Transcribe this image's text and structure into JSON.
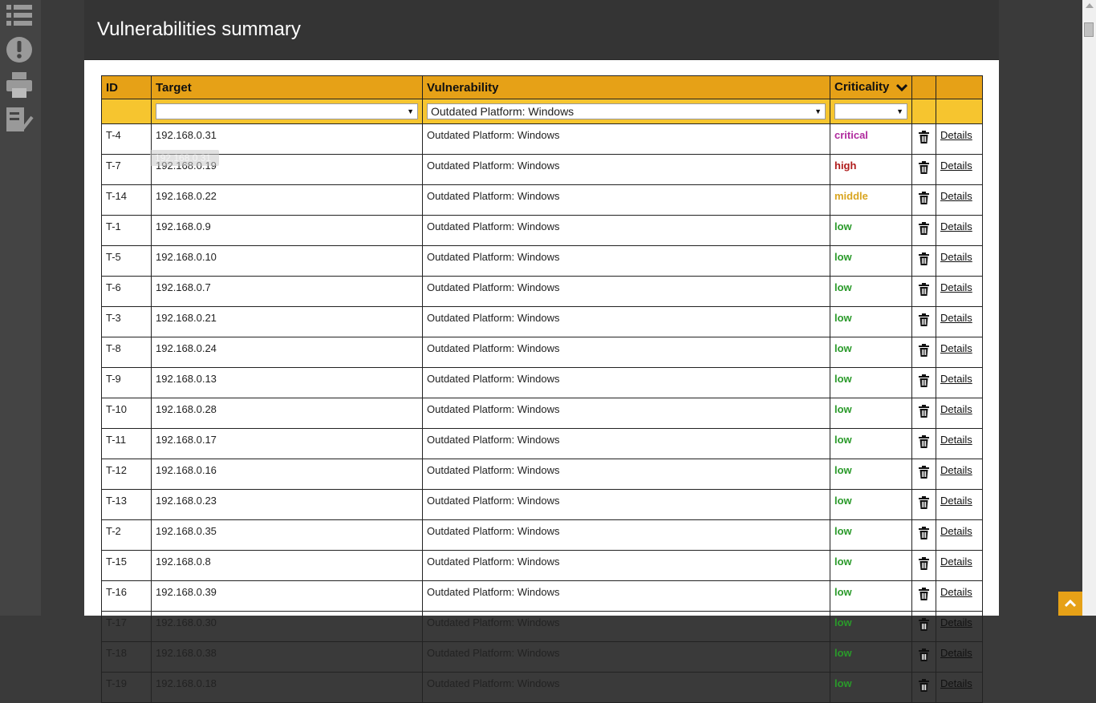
{
  "header": {
    "title": "Vulnerabilities summary"
  },
  "sidebar": {
    "icons": [
      "list-icon",
      "alert-icon",
      "print-icon",
      "checklist-icon"
    ]
  },
  "table": {
    "headers": {
      "id": "ID",
      "target": "Target",
      "vulnerability": "Vulnerability",
      "criticality": "Criticality"
    },
    "filters": {
      "target": "",
      "vulnerability": "Outdated Platform: Windows",
      "criticality": ""
    },
    "details_label": "Details",
    "rows": [
      {
        "id": "T-4",
        "target": "192.168.0.31",
        "vulnerability": "Outdated Platform: Windows",
        "criticality": "critical"
      },
      {
        "id": "T-7",
        "target": "192.168.0.19",
        "vulnerability": "Outdated Platform: Windows",
        "criticality": "high"
      },
      {
        "id": "T-14",
        "target": "192.168.0.22",
        "vulnerability": "Outdated Platform: Windows",
        "criticality": "middle"
      },
      {
        "id": "T-1",
        "target": "192.168.0.9",
        "vulnerability": "Outdated Platform: Windows",
        "criticality": "low"
      },
      {
        "id": "T-5",
        "target": "192.168.0.10",
        "vulnerability": "Outdated Platform: Windows",
        "criticality": "low"
      },
      {
        "id": "T-6",
        "target": "192.168.0.7",
        "vulnerability": "Outdated Platform: Windows",
        "criticality": "low"
      },
      {
        "id": "T-3",
        "target": "192.168.0.21",
        "vulnerability": "Outdated Platform: Windows",
        "criticality": "low"
      },
      {
        "id": "T-8",
        "target": "192.168.0.24",
        "vulnerability": "Outdated Platform: Windows",
        "criticality": "low"
      },
      {
        "id": "T-9",
        "target": "192.168.0.13",
        "vulnerability": "Outdated Platform: Windows",
        "criticality": "low"
      },
      {
        "id": "T-10",
        "target": "192.168.0.28",
        "vulnerability": "Outdated Platform: Windows",
        "criticality": "low"
      },
      {
        "id": "T-11",
        "target": "192.168.0.17",
        "vulnerability": "Outdated Platform: Windows",
        "criticality": "low"
      },
      {
        "id": "T-12",
        "target": "192.168.0.16",
        "vulnerability": "Outdated Platform: Windows",
        "criticality": "low"
      },
      {
        "id": "T-13",
        "target": "192.168.0.23",
        "vulnerability": "Outdated Platform: Windows",
        "criticality": "low"
      },
      {
        "id": "T-2",
        "target": "192.168.0.35",
        "vulnerability": "Outdated Platform: Windows",
        "criticality": "low"
      },
      {
        "id": "T-15",
        "target": "192.168.0.8",
        "vulnerability": "Outdated Platform: Windows",
        "criticality": "low"
      },
      {
        "id": "T-16",
        "target": "192.168.0.39",
        "vulnerability": "Outdated Platform: Windows",
        "criticality": "low"
      },
      {
        "id": "T-17",
        "target": "192.168.0.30",
        "vulnerability": "Outdated Platform: Windows",
        "criticality": "low"
      },
      {
        "id": "T-18",
        "target": "192.168.0.38",
        "vulnerability": "Outdated Platform: Windows",
        "criticality": "low"
      },
      {
        "id": "T-19",
        "target": "192.168.0.18",
        "vulnerability": "Outdated Platform: Windows",
        "criticality": "low"
      }
    ]
  },
  "tooltip": {
    "text": "192.168.0.31"
  },
  "colors": {
    "header_bg": "#343434",
    "table_header": "#e6a117",
    "filter_row": "#f6c52f",
    "critical": "#b02a9e",
    "high": "#b01c1c",
    "middle": "#d9a520",
    "low": "#2a9a2a"
  }
}
